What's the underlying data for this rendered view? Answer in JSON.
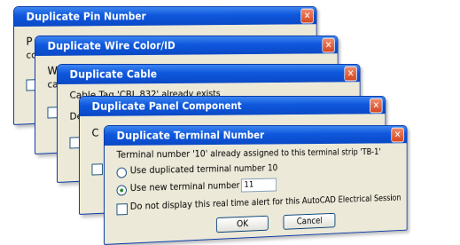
{
  "dialogs": [
    {
      "title": "Duplicate Pin Number",
      "fragments": [
        "P",
        "cc"
      ]
    },
    {
      "title": "Duplicate Wire Color/ID",
      "fragments": [
        "W",
        "ca"
      ]
    },
    {
      "title": "Duplicate Cable",
      "fragments": [
        "Cable Tag 'CBL 832' already exists",
        "De"
      ]
    },
    {
      "title": "Duplicate Panel Component",
      "fragments": [
        "C"
      ]
    }
  ],
  "front_dialog": {
    "title": "Duplicate Terminal Number",
    "message": "Terminal number '10' already assigned to this terminal strip 'TB-1'",
    "option_duplicate_label": "Use duplicated terminal number 10",
    "option_new_label": "Use new terminal number",
    "new_number_value": "11",
    "selected_option": "new",
    "checkbox_label": "Do not display this real time alert for this AutoCAD Electrical Session",
    "ok_label": "OK",
    "cancel_label": "Cancel"
  },
  "close_glyph": "✕",
  "colors": {
    "titlebar": "#0e57dd",
    "close": "#d5461f",
    "dialog_bg": "#ece9d8"
  }
}
